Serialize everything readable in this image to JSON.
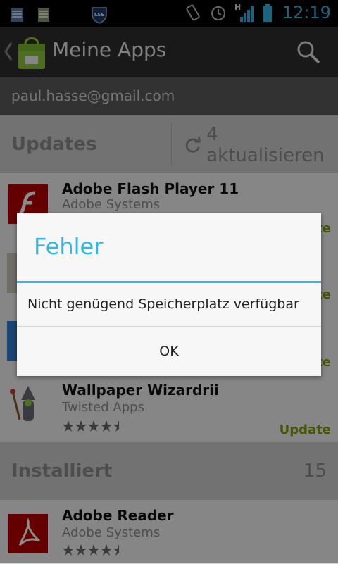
{
  "status_bar": {
    "time": "12:19",
    "network": "H",
    "badge_text": "LSE"
  },
  "action_bar": {
    "title": "Meine Apps"
  },
  "account": {
    "email": "paul.hasse@gmail.com"
  },
  "updates_section": {
    "label": "Updates",
    "update_all": "4 aktualisieren"
  },
  "apps_updates": [
    {
      "name": "Adobe Flash Player 11",
      "developer": "Adobe Systems",
      "action": "Update"
    },
    {
      "name": "Wallpaper Wizardrii",
      "developer": "Twisted Apps",
      "rating": 4.5,
      "action": "Update"
    }
  ],
  "installed_section": {
    "label": "Installiert",
    "count": "15"
  },
  "apps_installed": [
    {
      "name": "Adobe Reader",
      "developer": "Adobe Systems",
      "rating": 4.5
    }
  ],
  "dialog": {
    "title": "Fehler",
    "message": "Nicht genügend Speicherplatz verfügbar",
    "ok_label": "OK"
  },
  "colors": {
    "accent": "#33b5e5",
    "update_green": "#7aa100"
  }
}
